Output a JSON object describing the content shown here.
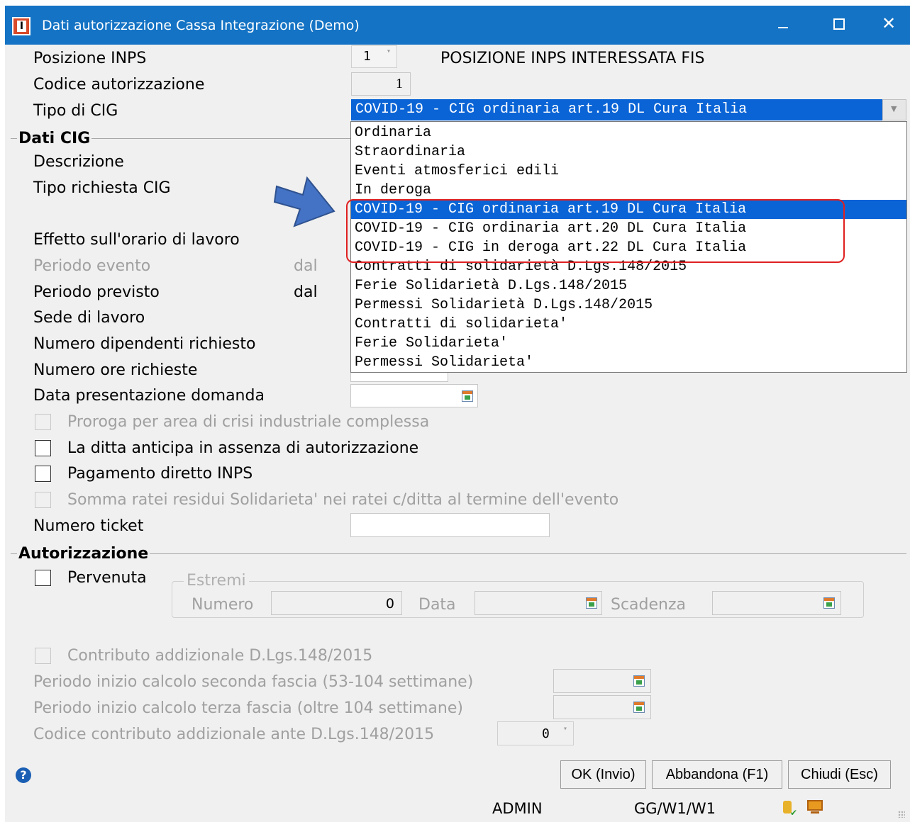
{
  "window": {
    "title": "Dati autorizzazione Cassa Integrazione  (Demo)",
    "app_icon_letter": "I"
  },
  "fields": {
    "posizione_inps": {
      "label": "Posizione INPS",
      "value": "1",
      "description": "POSIZIONE INPS INTERESSATA FIS"
    },
    "codice_autorizzazione": {
      "label": "Codice autorizzazione",
      "value": "1"
    },
    "tipo_cig": {
      "label": "Tipo di CIG",
      "value": "COVID-19 - CIG ordinaria art.19 DL Cura Italia"
    }
  },
  "dropdown": {
    "options": [
      "Ordinaria",
      "Straordinaria",
      "Eventi atmosferici edili",
      "In deroga",
      "COVID-19 - CIG ordinaria art.19 DL Cura Italia",
      "COVID-19 - CIG ordinaria art.20 DL Cura Italia",
      "COVID-19 - CIG in deroga art.22 DL Cura Italia",
      "Contratti di solidarietà D.Lgs.148/2015",
      "Ferie Solidarietà D.Lgs.148/2015",
      "Permessi Solidarietà D.Lgs.148/2015",
      "Contratti di solidarieta'",
      "Ferie Solidarieta'",
      "Permessi Solidarieta'"
    ],
    "selected_index": 4,
    "highlight_color": "#e02020",
    "selection_color": "#0a64d6"
  },
  "dati_cig": {
    "section_title": "Dati CIG",
    "descrizione": "Descrizione",
    "tipo_richiesta": "Tipo richiesta CIG",
    "effetto_orario": "Effetto sull'orario di lavoro",
    "periodo_evento": "Periodo evento",
    "periodo_evento_dal": "dal",
    "periodo_previsto": "Periodo previsto",
    "periodo_previsto_dal": "dal",
    "sede_lavoro": "Sede di lavoro",
    "numero_dipendenti": "Numero dipendenti richiesto",
    "numero_ore": "Numero ore richieste",
    "data_presentazione": "Data presentazione domanda",
    "proroga": "Proroga per area di crisi industriale complessa",
    "ditta_anticipa": "La ditta anticipa in assenza di autorizzazione",
    "pagamento_diretto": "Pagamento diretto INPS",
    "somma_ratei": "Somma ratei residui Solidarieta' nei ratei c/ditta al termine dell'evento",
    "numero_ticket": "Numero ticket"
  },
  "autorizzazione": {
    "section_title": "Autorizzazione",
    "pervenuta": "Pervenuta",
    "estremi_legend": "Estremi",
    "numero_label": "Numero",
    "numero_value": "0",
    "data_label": "Data",
    "scadenza_label": "Scadenza"
  },
  "contributo": {
    "contributo_addizionale": "Contributo addizionale D.Lgs.148/2015",
    "seconda_fascia": "Periodo inizio calcolo seconda fascia (53-104 settimane)",
    "terza_fascia": "Periodo inizio calcolo terza fascia (oltre 104 settimane)",
    "codice_ante": "Codice contributo addizionale ante D.Lgs.148/2015",
    "codice_ante_value": "0"
  },
  "buttons": {
    "ok": "OK (Invio)",
    "abbandona": "Abbandona (F1)",
    "chiudi": "Chiudi (Esc)"
  },
  "status": {
    "user": "ADMIN",
    "path": "GG/W1/W1"
  },
  "icons": [
    "app-icon",
    "minimize-icon",
    "maximize-icon",
    "close-icon",
    "calendar-icon",
    "help-icon",
    "database-icon",
    "computer-icon",
    "arrow-annotation"
  ]
}
